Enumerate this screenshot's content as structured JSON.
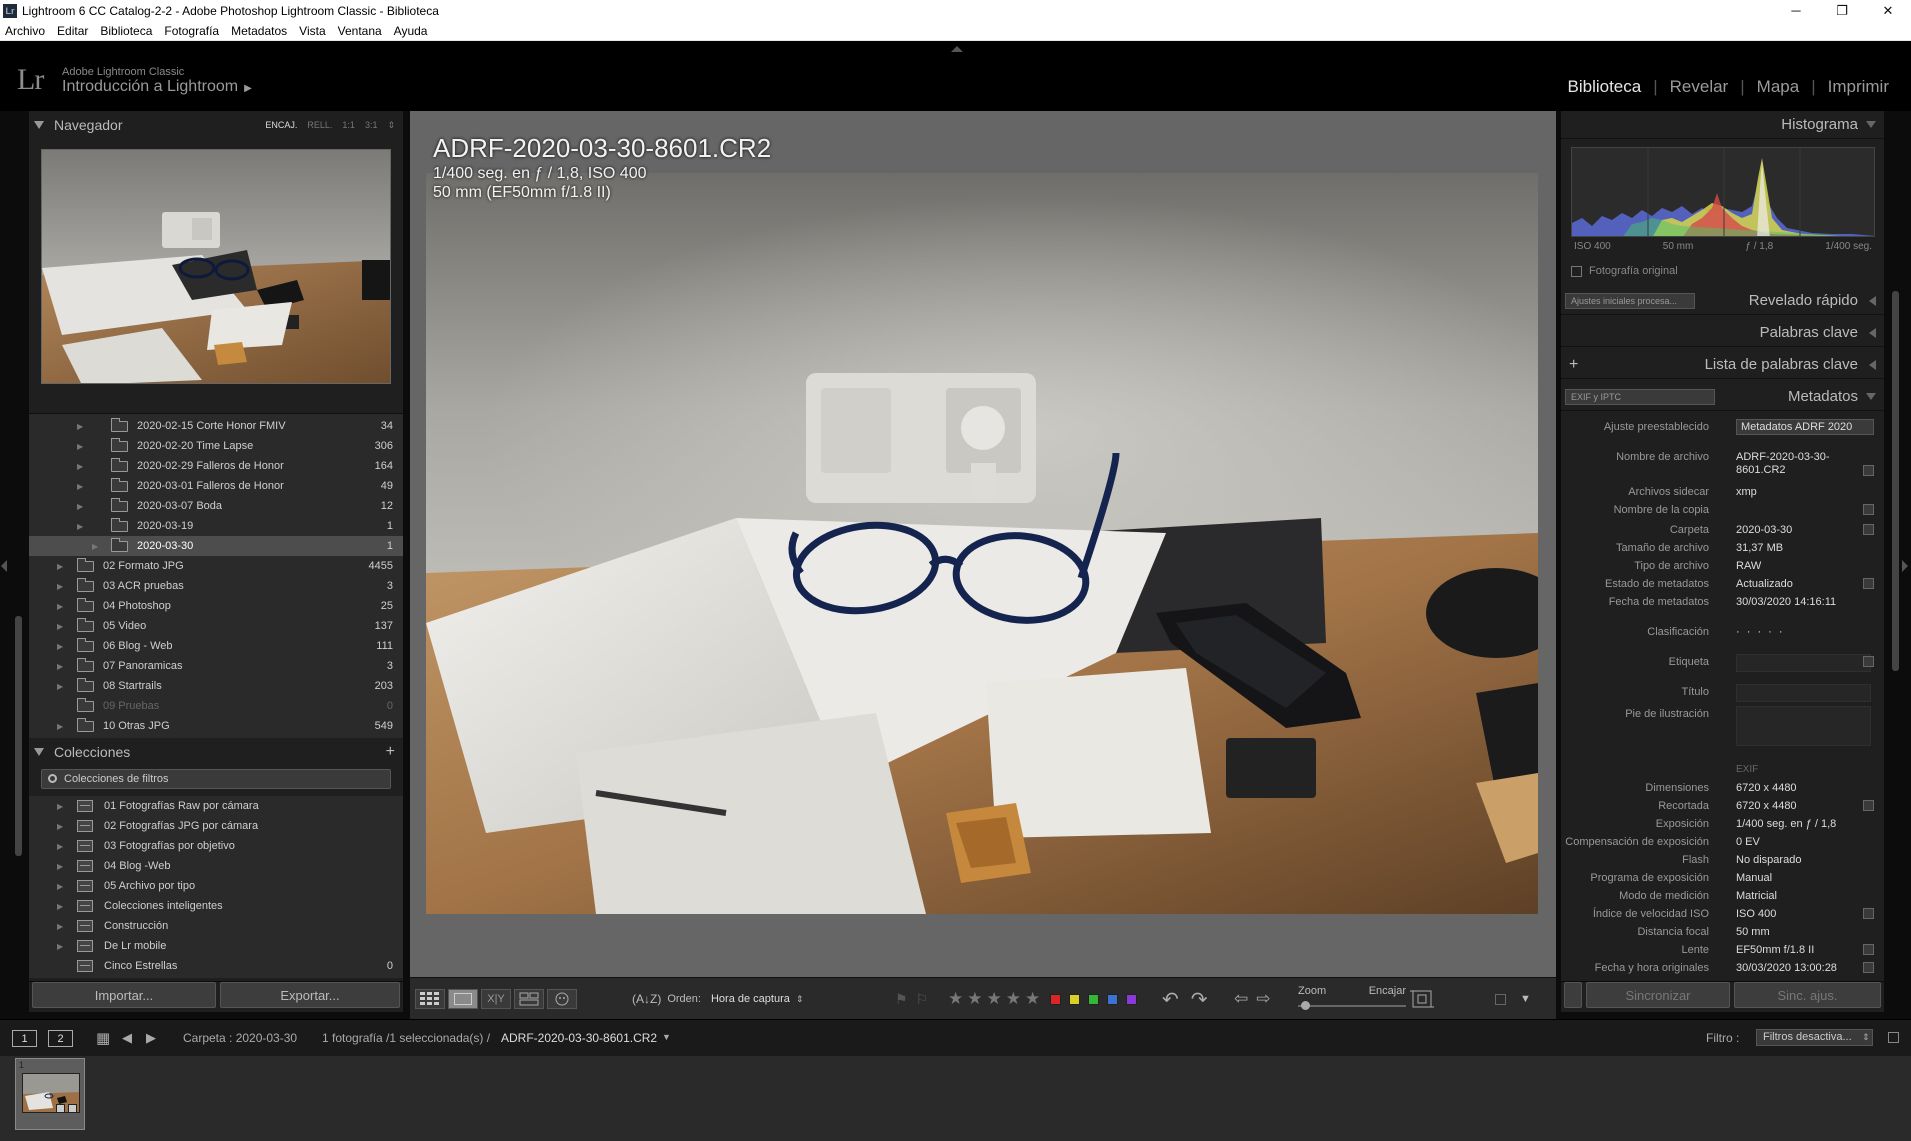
{
  "window": {
    "title": "Lightroom 6 CC Catalog-2-2 - Adobe Photoshop Lightroom Classic - Biblioteca",
    "app_icon": "Lr",
    "minimize": "─",
    "maximize": "❐",
    "close": "✕"
  },
  "menu": [
    "Archivo",
    "Editar",
    "Biblioteca",
    "Fotografía",
    "Metadatos",
    "Vista",
    "Ventana",
    "Ayuda"
  ],
  "identity": {
    "logo": "Lr",
    "product": "Adobe Lightroom Classic",
    "catalog": "Introducción a Lightroom",
    "catalog_arrow": "▶"
  },
  "modules": [
    "Biblioteca",
    "Revelar",
    "Mapa",
    "Imprimir"
  ],
  "active_module": "Biblioteca",
  "navigator": {
    "title": "Navegador",
    "options": [
      "ENCAJ.",
      "RELL.",
      "1:1",
      "3:1"
    ],
    "options_arrow": "⇕"
  },
  "folders": [
    {
      "label": "2020-02-15 Corte Honor FMIV",
      "count": "34",
      "level": 2,
      "selected": false,
      "dim": false
    },
    {
      "label": "2020-02-20 Time Lapse",
      "count": "306",
      "level": 2,
      "selected": false,
      "dim": false
    },
    {
      "label": "2020-02-29 Falleros de Honor",
      "count": "164",
      "level": 2,
      "selected": false,
      "dim": false
    },
    {
      "label": "2020-03-01 Falleros de Honor",
      "count": "49",
      "level": 2,
      "selected": false,
      "dim": false
    },
    {
      "label": "2020-03-07 Boda",
      "count": "12",
      "level": 2,
      "selected": false,
      "dim": false
    },
    {
      "label": "2020-03-19",
      "count": "1",
      "level": 2,
      "selected": false,
      "dim": false
    },
    {
      "label": "2020-03-30",
      "count": "1",
      "level": 2,
      "selected": true,
      "dim": false
    },
    {
      "label": "02 Formato JPG",
      "count": "4455",
      "level": 1,
      "selected": false,
      "dim": false
    },
    {
      "label": "03 ACR pruebas",
      "count": "3",
      "level": 1,
      "selected": false,
      "dim": false
    },
    {
      "label": "04 Photoshop",
      "count": "25",
      "level": 1,
      "selected": false,
      "dim": false
    },
    {
      "label": "05 Video",
      "count": "137",
      "level": 1,
      "selected": false,
      "dim": false
    },
    {
      "label": "06 Blog - Web",
      "count": "111",
      "level": 1,
      "selected": false,
      "dim": false
    },
    {
      "label": "07 Panoramicas",
      "count": "3",
      "level": 1,
      "selected": false,
      "dim": false
    },
    {
      "label": "08 Startrails",
      "count": "203",
      "level": 1,
      "selected": false,
      "dim": false
    },
    {
      "label": "09 Pruebas",
      "count": "0",
      "level": 1,
      "selected": false,
      "dim": true
    },
    {
      "label": "10 Otras JPG",
      "count": "549",
      "level": 1,
      "selected": false,
      "dim": false
    }
  ],
  "collections": {
    "title": "Colecciones",
    "add": "+",
    "filter": "Colecciones de filtros",
    "items": [
      {
        "label": "01 Fotografías Raw por cámara",
        "count": ""
      },
      {
        "label": "02 Fotografías JPG por cámara",
        "count": ""
      },
      {
        "label": "03 Fotografías por objetivo",
        "count": ""
      },
      {
        "label": "04 Blog -Web",
        "count": ""
      },
      {
        "label": "05 Archivo por tipo",
        "count": ""
      },
      {
        "label": "Colecciones inteligentes",
        "count": ""
      },
      {
        "label": "Construcción",
        "count": ""
      },
      {
        "label": "De Lr mobile",
        "count": ""
      },
      {
        "label": "Cinco Estrellas",
        "count": "0"
      }
    ]
  },
  "buttons": {
    "import": "Importar...",
    "export": "Exportar...",
    "sync": "Sincronizar",
    "sync_settings": "Sinc. ajus."
  },
  "photo_info": {
    "filename": "ADRF-2020-03-30-8601.CR2",
    "line1": "1/400 seg. en ƒ / 1,8, ISO 400",
    "line2": "50 mm (EF50mm f/1.8 II)"
  },
  "toolbar": {
    "sort_icon": "(A↓Z)",
    "sort_label": "Orden:",
    "sort_value": "Hora de captura",
    "sort_arrow": "⇕",
    "stars": "★★★★★",
    "flag_pick": "⚑",
    "flag_reject": "⚐",
    "rotate_left": "↶",
    "rotate_right": "↷",
    "prev": "⇦",
    "next": "⇨",
    "zoom_label": "Zoom",
    "zoom_value": "Encajar",
    "menu_arrow": "▼",
    "colors": [
      "#d92626",
      "#d9cf26",
      "#36b636",
      "#3a72d6",
      "#8a3ad6"
    ]
  },
  "histogram": {
    "title": "Histograma",
    "iso": "ISO 400",
    "focal": "50 mm",
    "aperture": "ƒ / 1,8",
    "shutter": "1/400 seg.",
    "original": "Fotografía original"
  },
  "quick_develop": {
    "title": "Revelado rápido",
    "preset": "Ajustes iniciales procesa..."
  },
  "keywording": {
    "title": "Palabras clave"
  },
  "keyword_list": {
    "title": "Lista de palabras clave",
    "add": "+"
  },
  "metadata": {
    "title": "Metadatos",
    "set": "EXIF y IPTC",
    "preset_label": "Ajuste preestablecido",
    "preset_value": "Metadatos ADRF 2020",
    "exif_header": "EXIF",
    "rows": [
      {
        "k": "Nombre de archivo",
        "v": "ADRF-2020-03-30-\n8601.CR2"
      },
      {
        "k": "Archivos sidecar",
        "v": "xmp"
      },
      {
        "k": "Nombre de la copia",
        "v": ""
      },
      {
        "k": "Carpeta",
        "v": "2020-03-30"
      },
      {
        "k": "Tamaño de archivo",
        "v": "31,37 MB"
      },
      {
        "k": "Tipo de archivo",
        "v": "RAW"
      },
      {
        "k": "Estado de metadatos",
        "v": "Actualizado"
      },
      {
        "k": "Fecha de metadatos",
        "v": "30/03/2020 14:16:11"
      },
      {
        "k": "Clasificación",
        "v": "· · · · ·"
      },
      {
        "k": "Etiqueta",
        "v": ""
      },
      {
        "k": "Título",
        "v": ""
      },
      {
        "k": "Pie de ilustración",
        "v": ""
      },
      {
        "k": "Dimensiones",
        "v": "6720 x 4480"
      },
      {
        "k": "Recortada",
        "v": "6720 x 4480"
      },
      {
        "k": "Exposición",
        "v": "1/400 seg. en ƒ / 1,8"
      },
      {
        "k": "Compensación de exposición",
        "v": "0 EV"
      },
      {
        "k": "Flash",
        "v": "No disparado"
      },
      {
        "k": "Programa de exposición",
        "v": "Manual"
      },
      {
        "k": "Modo de medición",
        "v": "Matricial"
      },
      {
        "k": "Índice de velocidad ISO",
        "v": "ISO 400"
      },
      {
        "k": "Distancia focal",
        "v": "50 mm"
      },
      {
        "k": "Lente",
        "v": "EF50mm f/1.8 II"
      },
      {
        "k": "Fecha y hora originales",
        "v": "30/03/2020 13:00:28"
      }
    ]
  },
  "filmbar": {
    "screen1": "1",
    "screen2": "2",
    "grid_icon": "▦",
    "back": "◀",
    "forward": "▶",
    "source": "Carpeta : 2020-03-30",
    "count": "1 fotografía /1 seleccionada(s) /",
    "file": "ADRF-2020-03-30-8601.CR2",
    "file_arrow": "▼",
    "filter_label": "Filtro :",
    "filter_value": "Filtros desactiva...",
    "filter_arrow": "⇕"
  },
  "filmstrip": {
    "thumb_number": "1"
  }
}
